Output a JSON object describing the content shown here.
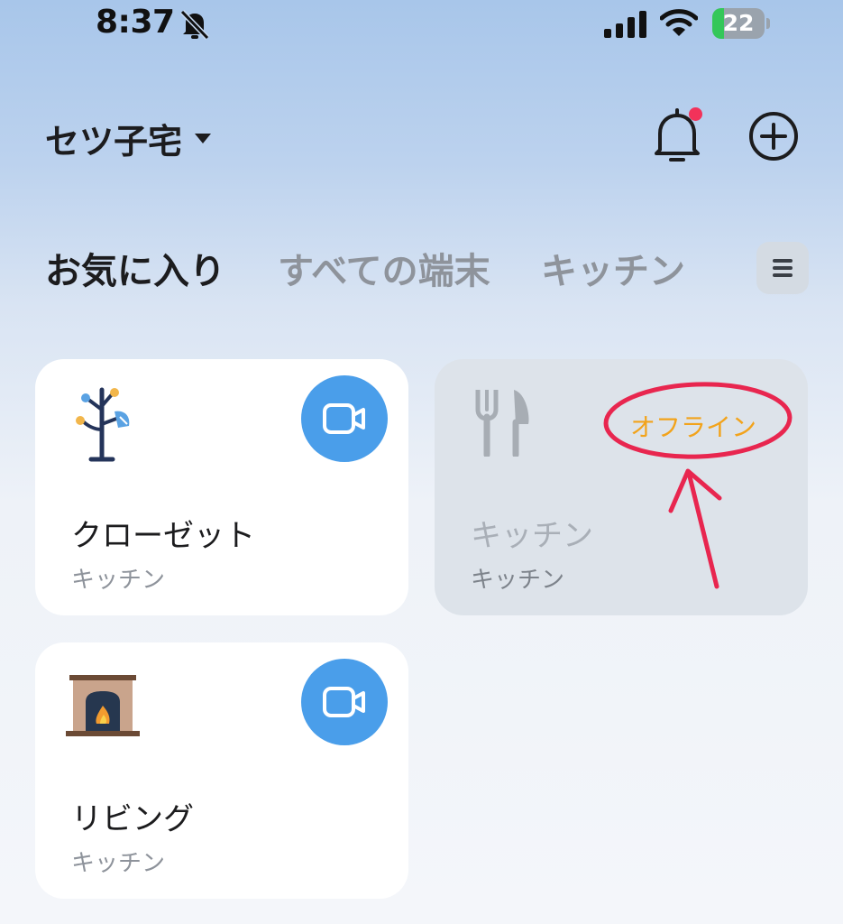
{
  "status_bar": {
    "time": "8:37",
    "battery": "22",
    "battery_level": 0.22,
    "icons": [
      "bell-slash-icon",
      "cellular-signal-icon",
      "wifi-icon",
      "battery-charging-icon"
    ]
  },
  "header": {
    "home_name": "セツ子宅",
    "has_notification_badge": true
  },
  "tabs": [
    {
      "label": "お気に入り",
      "active": true
    },
    {
      "label": "すべての端末",
      "active": false
    },
    {
      "label": "キッチン",
      "active": false
    }
  ],
  "devices": [
    {
      "name": "クローゼット",
      "room": "キッチン",
      "icon": "coat-rack-icon",
      "action_icon": "video-camera-icon"
    },
    {
      "name": "キッチン",
      "room": "キッチン",
      "icon": "fork-knife-icon",
      "status": "オフライン"
    },
    {
      "name": "リビング",
      "room": "キッチン",
      "icon": "fireplace-icon",
      "action_icon": "video-camera-icon"
    }
  ],
  "colors": {
    "accent_blue": "#4a9eea",
    "offline_orange": "#f2a31b",
    "annotation_red": "#e8264f",
    "notification_dot": "#f2325a"
  }
}
